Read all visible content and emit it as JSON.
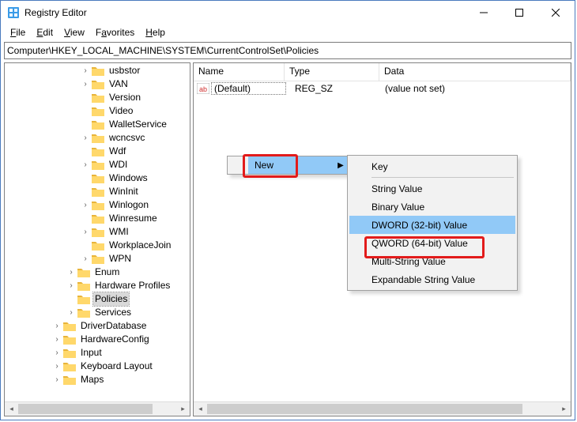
{
  "window": {
    "title": "Registry Editor"
  },
  "menu": {
    "file": "File",
    "edit": "Edit",
    "view": "View",
    "favorites": "Favorites",
    "help": "Help"
  },
  "address": "Computer\\HKEY_LOCAL_MACHINE\\SYSTEM\\CurrentControlSet\\Policies",
  "columns": {
    "name": "Name",
    "type": "Type",
    "data": "Data"
  },
  "row0": {
    "name": "(Default)",
    "type": "REG_SZ",
    "data": "(value not set)"
  },
  "tree": {
    "n0": "usbstor",
    "n1": "VAN",
    "n2": "Version",
    "n3": "Video",
    "n4": "WalletService",
    "n5": "wcncsvc",
    "n6": "Wdf",
    "n7": "WDI",
    "n8": "Windows",
    "n9": "WinInit",
    "n10": "Winlogon",
    "n11": "Winresume",
    "n12": "WMI",
    "n13": "WorkplaceJoin",
    "n14": "WPN",
    "n15": "Enum",
    "n16": "Hardware Profiles",
    "n17": "Policies",
    "n18": "Services",
    "n19": "DriverDatabase",
    "n20": "HardwareConfig",
    "n21": "Input",
    "n22": "Keyboard Layout",
    "n23": "Maps"
  },
  "ctx": {
    "new": "New",
    "key": "Key",
    "string": "String Value",
    "binary": "Binary Value",
    "dword": "DWORD (32-bit) Value",
    "qword": "QWORD (64-bit) Value",
    "multi": "Multi-String Value",
    "expand": "Expandable String Value"
  }
}
